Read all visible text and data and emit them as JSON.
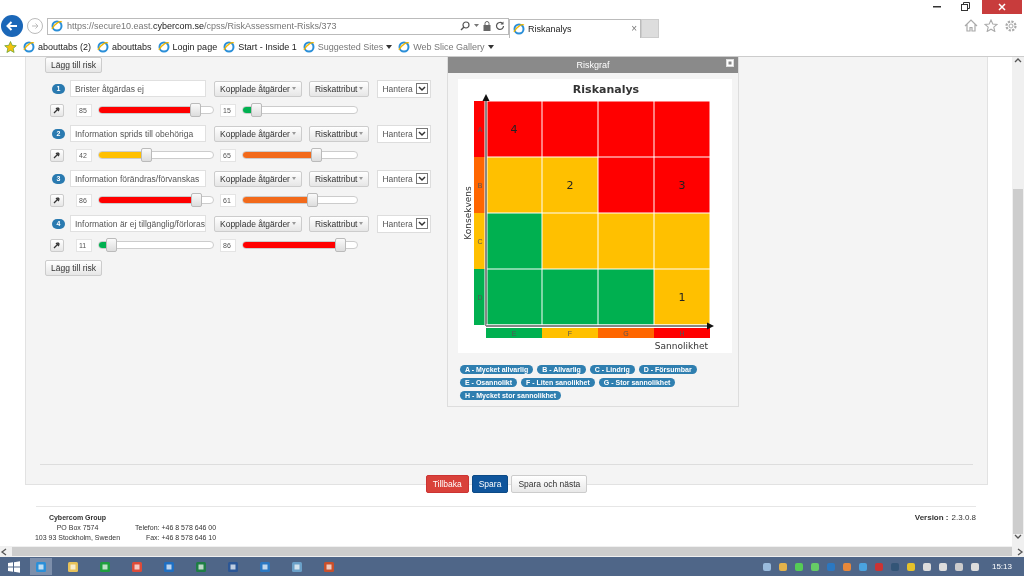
{
  "browser": {
    "url": "https://secure10.east.**cybercom.se**/cpss/RiskAssessment-Risks/373",
    "tab": "Riskanalys",
    "tab_close": "×",
    "favorites": [
      {
        "label": "abouttabs (2)",
        "menu": false
      },
      {
        "label": "abouttabs",
        "menu": false
      },
      {
        "label": "Login page",
        "menu": false
      },
      {
        "label": "Start - Inside 1",
        "menu": false
      },
      {
        "label": "Suggested Sites",
        "menu": true
      },
      {
        "label": "Web Slice Gallery",
        "menu": true
      }
    ]
  },
  "top_button": "Lägg till risk",
  "risks": [
    {
      "number": "1",
      "name": "Brister åtgärdas ej",
      "linked_button": "Kopplade åtgärder",
      "attribute_button": "Riskattribut",
      "action": "Hantera",
      "consequence": {
        "value": "85",
        "level": 0.85,
        "color": "#ff0000"
      },
      "probability": {
        "value": "15",
        "level": 0.12,
        "color": "#00b050"
      }
    },
    {
      "number": "2",
      "name": "Information sprids till obehöriga",
      "linked_button": "Kopplade åtgärder",
      "attribute_button": "Riskattribut",
      "action": "Hantera",
      "consequence": {
        "value": "42",
        "level": 0.42,
        "color": "#ffc000"
      },
      "probability": {
        "value": "65",
        "level": 0.65,
        "color": "#f26a1b"
      }
    },
    {
      "number": "3",
      "name": "Information förändras/förvanskas",
      "linked_button": "Kopplade åtgärder",
      "attribute_button": "Riskattribut",
      "action": "Hantera",
      "consequence": {
        "value": "86",
        "level": 0.86,
        "color": "#ff0000"
      },
      "probability": {
        "value": "61",
        "level": 0.61,
        "color": "#f26a1b"
      }
    },
    {
      "number": "4",
      "name": "Information är ej tillgänglig/förloras",
      "linked_button": "Kopplade åtgärder",
      "attribute_button": "Riskattribut",
      "action": "Hantera",
      "consequence": {
        "value": "11",
        "level": 0.11,
        "color": "#00b050"
      },
      "probability": {
        "value": "86",
        "level": 0.86,
        "color": "#ff0000"
      }
    }
  ],
  "bottom_button": "Lägg till risk",
  "graph_panel": {
    "title": "Riskgraf",
    "matrix": {
      "title": "Riskanalys",
      "y_label": "Konsekvens",
      "x_label": "Sannolikhet",
      "consequence_bands": [
        {
          "label": "A",
          "color": "#ff0000",
          "squares": [
            {
              "color": "#ff0000",
              "marker": "4"
            },
            {
              "color": "#ff0000"
            },
            {
              "color": "#ff0000"
            },
            {
              "color": "#ff0000"
            }
          ]
        },
        {
          "label": "B",
          "color": "#ff6600",
          "squares": [
            {
              "color": "#ffc000"
            },
            {
              "color": "#ffc000",
              "marker": "2"
            },
            {
              "color": "#ff0000"
            },
            {
              "color": "#ff0000",
              "marker": "3"
            }
          ]
        },
        {
          "label": "C",
          "color": "#ffc000",
          "squares": [
            {
              "color": "#00b050"
            },
            {
              "color": "#ffc000"
            },
            {
              "color": "#ffc000"
            },
            {
              "color": "#ffc000"
            }
          ]
        },
        {
          "label": "D",
          "color": "#00b050",
          "squares": [
            {
              "color": "#00b050"
            },
            {
              "color": "#00b050"
            },
            {
              "color": "#00b050"
            },
            {
              "color": "#ffc000",
              "marker": "1"
            }
          ]
        }
      ],
      "probability_bands": [
        {
          "label": "E",
          "color": "#00b050"
        },
        {
          "label": "F",
          "color": "#ffc000"
        },
        {
          "label": "G",
          "color": "#ff6600"
        },
        {
          "label": "H",
          "color": "#ff0000"
        }
      ]
    },
    "legend": [
      "A - Mycket allvarlig",
      "B - Allvarlig",
      "C - Lindrig",
      "D - Försumbar",
      "E - Osannolikt",
      "F - Liten sanolikhet",
      "G - Stor sannolikhet",
      "H - Mycket stor sannolikhet"
    ]
  },
  "actions": [
    {
      "label": "Tillbaka",
      "kind": "danger"
    },
    {
      "label": "Spara",
      "kind": "primary"
    },
    {
      "label": "Spara och nästa",
      "kind": "default"
    }
  ],
  "footer": {
    "company": "Cybercom Group",
    "address": [
      "PO Box 7574",
      "103 93 Stockholm, Sweden"
    ],
    "contact": [
      "Telefon: +46 8 578 646 00",
      "Fax: +46 8 578 646 10"
    ],
    "version_label": "Version :",
    "version": "2.3.0.8"
  },
  "taskbar": {
    "clock": "15:13"
  }
}
